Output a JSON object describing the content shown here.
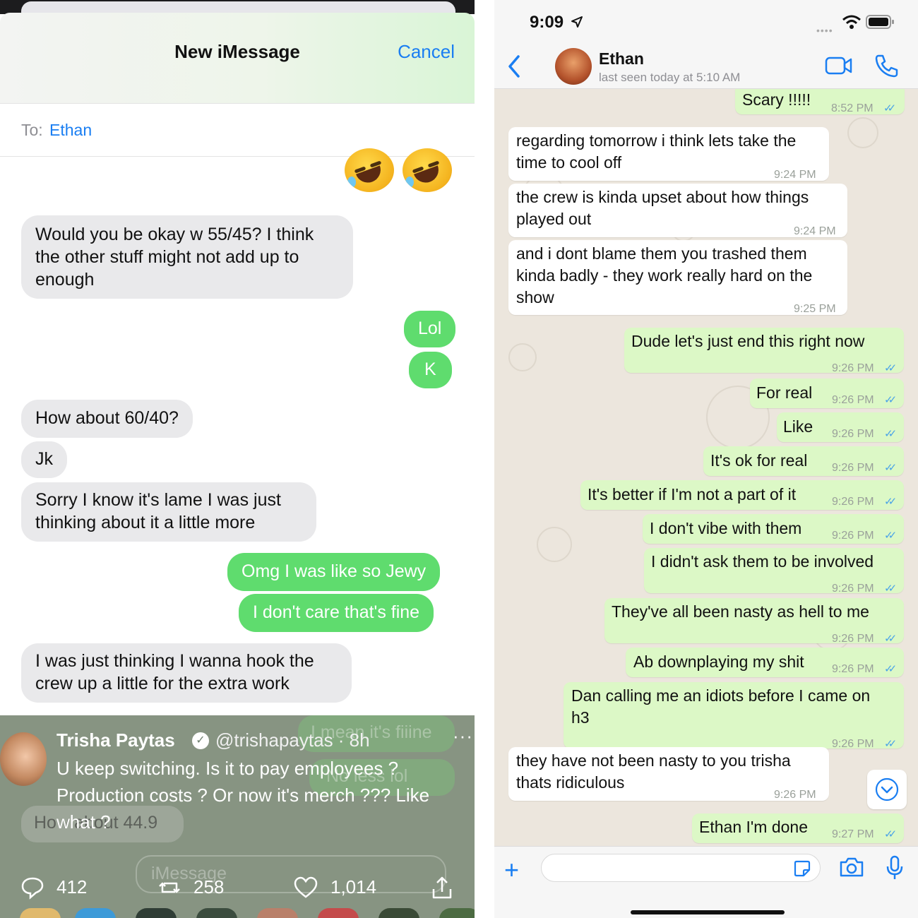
{
  "imessage": {
    "title": "New iMessage",
    "cancel": "Cancel",
    "to_label": "To:",
    "to_name": "Ethan",
    "emoji_name": "rolling-on-floor-laughing-emoji",
    "messages": [
      {
        "side": "in",
        "text": "Would you be okay w 55/45? I think"
      },
      {
        "side": "in",
        "text": "the other stuff might not add up to"
      },
      {
        "side": "in",
        "text": "enough"
      },
      {
        "side": "out",
        "text": "Lol"
      },
      {
        "side": "out",
        "text": "K"
      },
      {
        "side": "in",
        "text": "How about 60/40?"
      },
      {
        "side": "in",
        "text": "Jk"
      },
      {
        "side": "in",
        "text": "Sorry I know it's lame I was just"
      },
      {
        "side": "in",
        "text": "thinking about it a little more"
      },
      {
        "side": "out",
        "text": "Omg I was like so Jewy"
      },
      {
        "side": "out",
        "text": "I don't care that's fine"
      },
      {
        "side": "in",
        "text": "I was just thinking I wanna hook the"
      },
      {
        "side": "in",
        "text": "crew up a little for the extra work"
      }
    ],
    "ghost_out_1": "I mean it's fiiine",
    "ghost_out_2": "No less lol",
    "ghost_in": "How about 44.9",
    "ghost_placeholder": "iMessage"
  },
  "tweet": {
    "name": "Trisha Paytas",
    "handle": "@trishapaytas · 8h",
    "more": "···",
    "body_lines": [
      "U keep switching. Is it to pay employees ?",
      "Production costs ? Or now it's merch ??? Like",
      "what ?"
    ],
    "replies": "412",
    "retweets": "258",
    "likes": "1,014"
  },
  "whatsapp": {
    "time": "9:09",
    "contact_name": "Ethan",
    "last_seen": "last seen today at 5:10 AM",
    "colors": {
      "outgoing": "#dcf8c6",
      "incoming": "#ffffff",
      "accent": "#1a7ef2",
      "ticks": "#4aa3e8"
    },
    "messages": [
      {
        "side": "out",
        "lines": [
          "Scary !!!!!"
        ],
        "time": "8:52 PM"
      },
      {
        "side": "in",
        "lines": [
          "regarding tomorrow i think lets take the",
          "time to cool off"
        ],
        "time": "9:24 PM"
      },
      {
        "side": "in",
        "lines": [
          "the crew is kinda upset about how things",
          "played out"
        ],
        "time": "9:24 PM"
      },
      {
        "side": "in",
        "lines": [
          "and i dont blame them you trashed them",
          "kinda badly - they work really hard on the",
          "show"
        ],
        "time": "9:25 PM"
      },
      {
        "side": "out",
        "lines": [
          "Dude let's just end this right now"
        ],
        "time": "9:26 PM"
      },
      {
        "side": "out",
        "lines": [
          "For real"
        ],
        "time": "9:26 PM"
      },
      {
        "side": "out",
        "lines": [
          "Like"
        ],
        "time": "9:26 PM"
      },
      {
        "side": "out",
        "lines": [
          "It's ok for real"
        ],
        "time": "9:26 PM"
      },
      {
        "side": "out",
        "lines": [
          "It's better if I'm not a part of it"
        ],
        "time": "9:26 PM"
      },
      {
        "side": "out",
        "lines": [
          "I don't vibe with them"
        ],
        "time": "9:26 PM"
      },
      {
        "side": "out",
        "lines": [
          "I didn't ask them to be involved"
        ],
        "time": "9:26 PM"
      },
      {
        "side": "out",
        "lines": [
          "They've all been nasty as hell to me"
        ],
        "time": "9:26 PM"
      },
      {
        "side": "out",
        "lines": [
          "Ab downplaying my shit"
        ],
        "time": "9:26 PM"
      },
      {
        "side": "out",
        "lines": [
          "Dan calling me an idiots before I came on",
          "h3"
        ],
        "time": "9:26 PM"
      },
      {
        "side": "in",
        "lines": [
          "they have not been nasty to you trisha",
          "thats ridiculous"
        ],
        "time": "9:26 PM"
      },
      {
        "side": "out",
        "lines": [
          "Ethan I'm done"
        ],
        "time": "9:27 PM"
      }
    ]
  }
}
